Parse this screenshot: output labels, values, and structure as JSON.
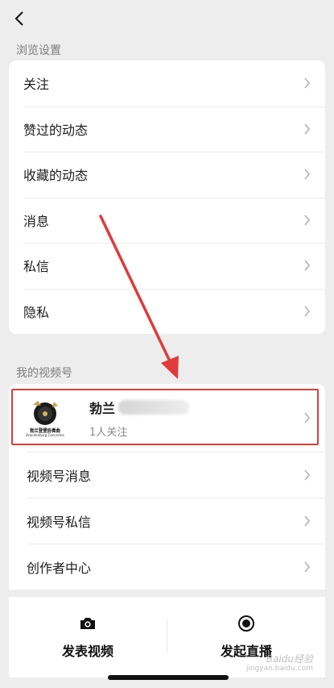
{
  "header": {
    "back_icon": "chevron-left-icon"
  },
  "browse_section": {
    "label": "浏览设置",
    "items": [
      "关注",
      "赞过的动态",
      "收藏的动态",
      "消息",
      "私信",
      "隐私"
    ]
  },
  "channel_section": {
    "label": "我的视频号",
    "profile": {
      "name": "勃兰",
      "followers": "1人关注",
      "avatar_caption": "勃兰登堡协奏曲",
      "avatar_subcaption": "Brandenburg Concertos"
    },
    "items": [
      "视频号消息",
      "视频号私信",
      "创作者中心"
    ]
  },
  "bottom_actions": {
    "post_video": {
      "label": "发表视频",
      "icon": "camera-icon"
    },
    "start_live": {
      "label": "发起直播",
      "icon": "live-record-icon"
    }
  },
  "watermark": {
    "text": "Baidu经验",
    "url": "jingyan.baidu.com"
  },
  "colors": {
    "background": "#ededed",
    "card": "#ffffff",
    "annotation": "#e03b3b"
  }
}
